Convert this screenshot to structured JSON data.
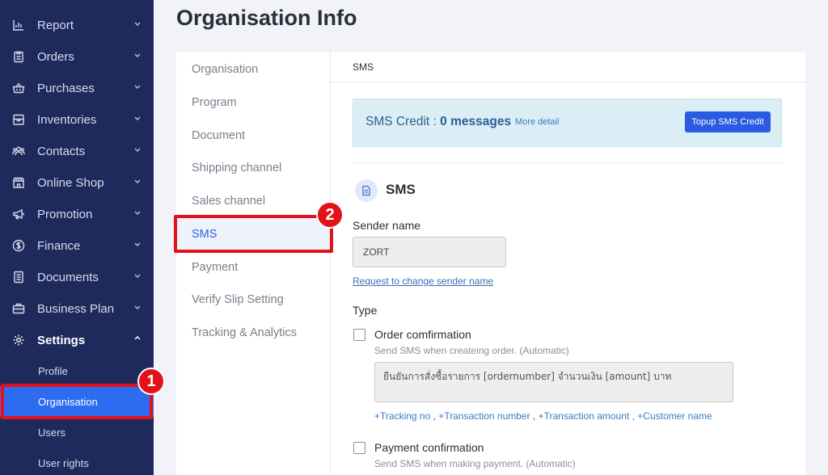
{
  "sidebar": {
    "items": [
      {
        "label": "Report",
        "icon": "bar-chart-icon"
      },
      {
        "label": "Orders",
        "icon": "clipboard-icon"
      },
      {
        "label": "Purchases",
        "icon": "basket-icon"
      },
      {
        "label": "Inventories",
        "icon": "box-icon"
      },
      {
        "label": "Contacts",
        "icon": "people-icon"
      },
      {
        "label": "Online Shop",
        "icon": "shop-icon"
      },
      {
        "label": "Promotion",
        "icon": "megaphone-icon"
      },
      {
        "label": "Finance",
        "icon": "dollar-icon"
      },
      {
        "label": "Documents",
        "icon": "document-icon"
      },
      {
        "label": "Business Plan",
        "icon": "briefcase-icon"
      },
      {
        "label": "Settings",
        "icon": "gear-icon"
      }
    ],
    "settings_sub": [
      {
        "label": "Profile"
      },
      {
        "label": "Organisation"
      },
      {
        "label": "Users"
      },
      {
        "label": "User rights"
      }
    ],
    "colors": {
      "background": "#1f2a5c",
      "selected": "#2d6cf0"
    }
  },
  "steps": {
    "one": "1",
    "two": "2",
    "color": "#e4111a"
  },
  "page": {
    "title": "Organisation Info"
  },
  "settings_menu": {
    "items": [
      {
        "label": "Organisation"
      },
      {
        "label": "Program"
      },
      {
        "label": "Document"
      },
      {
        "label": "Shipping channel"
      },
      {
        "label": "Sales channel"
      },
      {
        "label": "SMS"
      },
      {
        "label": "Payment"
      },
      {
        "label": "Verify Slip Setting"
      },
      {
        "label": "Tracking & Analytics"
      }
    ],
    "selected": "SMS"
  },
  "content": {
    "tab": "SMS",
    "credit": {
      "prefix": "SMS Credit : ",
      "value": "0 messages",
      "more_detail": "More detail",
      "topup_button": "Topup SMS Credit"
    },
    "section_title": "SMS",
    "sender_name_label": "Sender name",
    "sender_name_value": "ZORT",
    "change_link": "Request to change sender name",
    "type_label": "Type",
    "order_confirmation": {
      "label": "Order comfirmation",
      "description": "Send SMS when createing order. (Automatic)",
      "message": "ยืนยันการสั่งซื้อรายการ [ordernumber] จำนวนเงิน [amount] บาท"
    },
    "variables": [
      "+Tracking no",
      "+Transaction number",
      "+Transaction amount",
      "+Customer name"
    ],
    "variable_separator": ",",
    "payment_confirmation": {
      "label": "Payment confirmation",
      "description": "Send SMS when making payment. (Automatic)"
    }
  }
}
